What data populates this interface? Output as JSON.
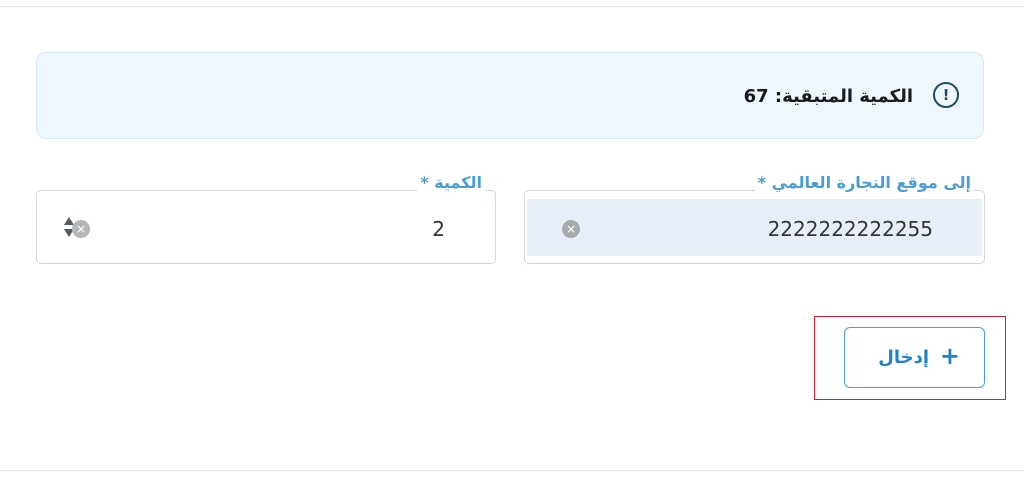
{
  "alert": {
    "text": "الكمية المتبقية: 67",
    "icon": "exclamation-circle-icon"
  },
  "destination_field": {
    "label": "إلى موقع التجارة العالمي *",
    "value": "2222222222255",
    "clear_icon": "clear-circle-icon"
  },
  "quantity_field": {
    "label": "الكمية *",
    "value": "2",
    "clear_icon": "clear-circle-icon",
    "spin_icon": "spinner-arrows-icon"
  },
  "enter_button": {
    "label": "إدخال",
    "icon": "plus-icon"
  },
  "colors": {
    "accent": "#1f83c9",
    "label": "#4a9ed6",
    "alert_bg": "#eef7fd",
    "highlight": "#d21f2a"
  }
}
